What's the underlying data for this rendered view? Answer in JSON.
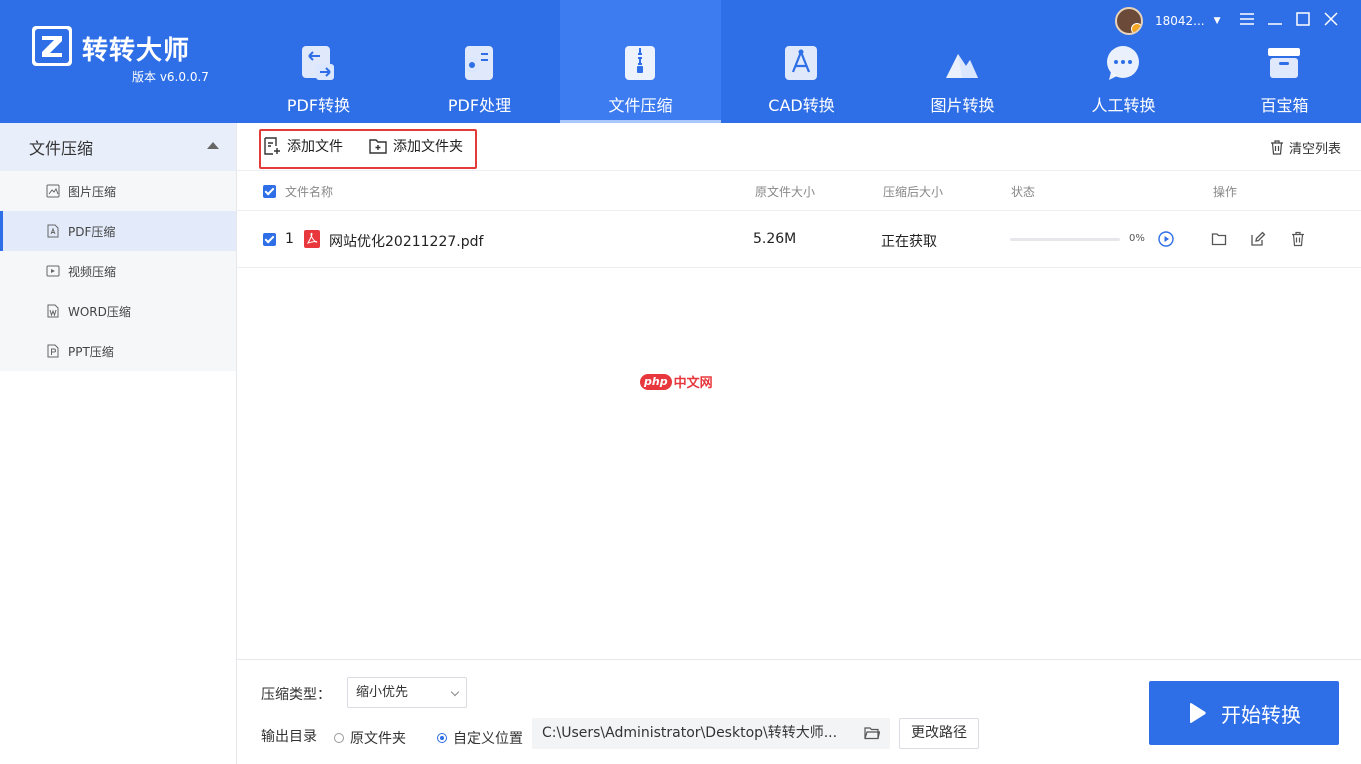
{
  "app": {
    "brand": "转转大师",
    "version": "版本 v6.0.0.7",
    "accent_color": "#2e6ee6"
  },
  "nav": {
    "tabs": [
      {
        "label": "PDF转换",
        "icon": "pdf-convert-icon"
      },
      {
        "label": "PDF处理",
        "icon": "pdf-process-icon"
      },
      {
        "label": "文件压缩",
        "icon": "file-compress-icon",
        "active": true
      },
      {
        "label": "CAD转换",
        "icon": "cad-convert-icon"
      },
      {
        "label": "图片转换",
        "icon": "image-convert-icon"
      },
      {
        "label": "人工转换",
        "icon": "manual-convert-icon"
      },
      {
        "label": "百宝箱",
        "icon": "toolbox-icon"
      }
    ]
  },
  "user": {
    "name": "18042..."
  },
  "sidebar": {
    "header": "文件压缩",
    "items": [
      {
        "label": "图片压缩",
        "icon": "image-file-icon"
      },
      {
        "label": "PDF压缩",
        "icon": "pdf-file-icon",
        "active": true
      },
      {
        "label": "视频压缩",
        "icon": "video-file-icon"
      },
      {
        "label": "WORD压缩",
        "icon": "word-file-icon"
      },
      {
        "label": "PPT压缩",
        "icon": "ppt-file-icon"
      }
    ]
  },
  "toolbar": {
    "add_file": "添加文件",
    "add_folder": "添加文件夹",
    "clear_list": "清空列表"
  },
  "table": {
    "headers": {
      "name": "文件名称",
      "original_size": "原文件大小",
      "compressed_size": "压缩后大小",
      "status": "状态",
      "actions": "操作"
    },
    "rows": [
      {
        "index": "1",
        "name": "网站优化20211227.pdf",
        "original_size": "5.26M",
        "compressed_size": "正在获取",
        "progress_percent": 0,
        "progress_text": "0%"
      }
    ]
  },
  "watermark": {
    "badge": "php",
    "text": "中文网"
  },
  "footer": {
    "compress_type_label": "压缩类型：",
    "compress_type_value": "缩小优先",
    "output_dir_label": "输出目录",
    "radio_original": "原文件夹",
    "radio_custom": "自定义位置",
    "selected_output": "custom",
    "path": "C:\\Users\\Administrator\\Desktop\\转转大师...",
    "change_path": "更改路径",
    "start": "开始转换"
  }
}
